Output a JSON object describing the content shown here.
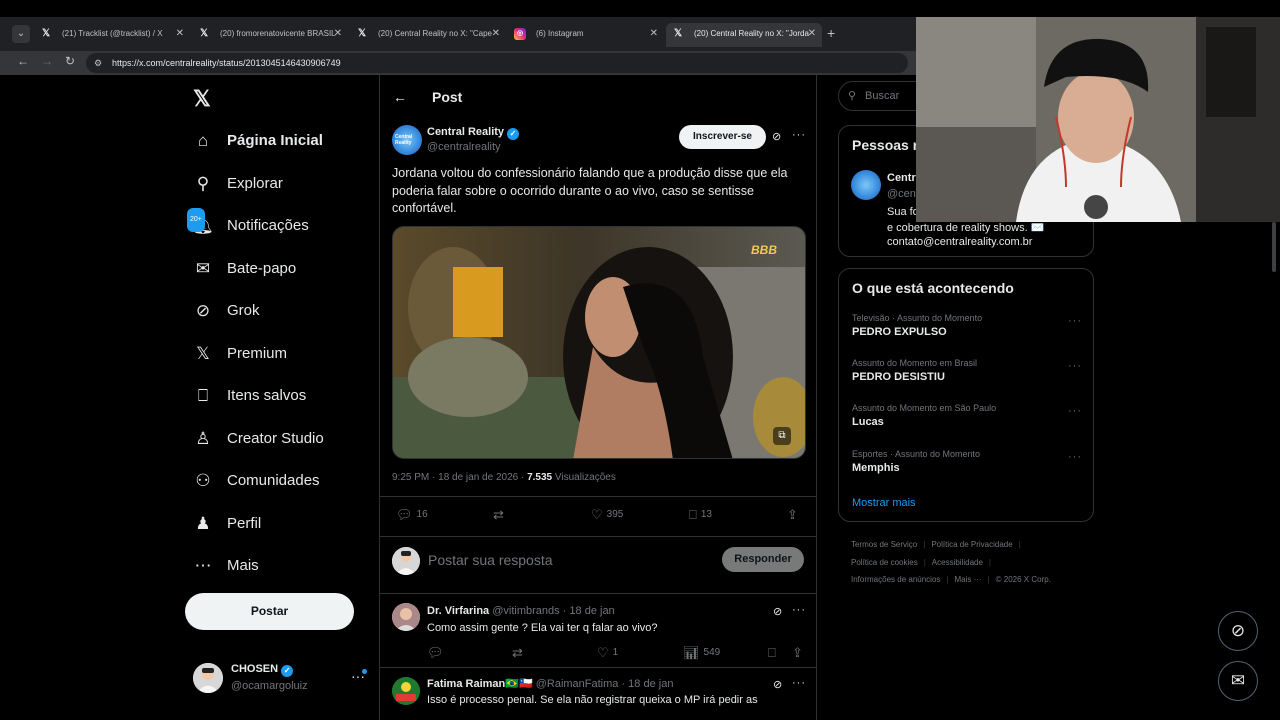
{
  "browser": {
    "tabs": [
      {
        "title": "(21) Tracklist (@tracklist) / X",
        "icon": "x-logo"
      },
      {
        "title": "(20) fromorenatovicente BRASIL",
        "icon": "x-logo"
      },
      {
        "title": "(20) Central Reality no X: \"Cape",
        "icon": "x-logo"
      },
      {
        "title": "(6) Instagram",
        "icon": "instagram-logo"
      },
      {
        "title": "(20) Central Reality no X: \"Jorda",
        "icon": "x-logo",
        "active": true
      }
    ],
    "url": "https://x.com/centralreality/status/2013045146430906749"
  },
  "nav": {
    "items": [
      {
        "label": "Página Inicial",
        "icon": "home-icon"
      },
      {
        "label": "Explorar",
        "icon": "search-icon"
      },
      {
        "label": "Notificações",
        "icon": "bell-icon",
        "badge": "20+"
      },
      {
        "label": "Bate-papo",
        "icon": "mail-icon"
      },
      {
        "label": "Grok",
        "icon": "grok-icon"
      },
      {
        "label": "Premium",
        "icon": "x-logo-icon"
      },
      {
        "label": "Itens salvos",
        "icon": "bookmark-icon"
      },
      {
        "label": "Creator Studio",
        "icon": "creator-studio-icon"
      },
      {
        "label": "Comunidades",
        "icon": "communities-icon"
      },
      {
        "label": "Perfil",
        "icon": "profile-icon"
      },
      {
        "label": "Mais",
        "icon": "more-circle-icon"
      }
    ],
    "post_button": "Postar",
    "account": {
      "name": "CHOSEN",
      "handle": "@ocamargoluiz"
    }
  },
  "post": {
    "header": "Post",
    "author": {
      "name": "Central Reality",
      "handle": "@centralreality",
      "avatar_text": "Central Reality"
    },
    "subscribe_label": "Inscrever-se",
    "text": "Jordana voltou do confessionário falando que a produção disse que ela poderia falar sobre o ocorrido durante o ao vivo, caso se sentisse confortável.",
    "media_badge": "BBB",
    "timestamp": "9:25 PM · 18 de jan de 2026 · ",
    "views_count": "7.535",
    "views_label": "Visualizações",
    "stats": {
      "replies": "16",
      "retweets": "",
      "likes": "395",
      "bookmarks": "13"
    }
  },
  "reply_box": {
    "placeholder": "Postar sua resposta",
    "button": "Responder"
  },
  "replies": [
    {
      "name": "Dr. Virfarina",
      "handle": "@vitimbrands · 18 de jan",
      "text": "Como assim gente ? Ela vai ter q falar ao vivo?",
      "replies": "",
      "retweets": "",
      "likes": "1",
      "views": "549"
    },
    {
      "name": "Fatima Raiman",
      "flags": "🇧🇷🇨🇱",
      "handle": "@RaimanFatima · 18 de jan",
      "text": "Isso é  processo penal. Se ela não registrar queixa o MP irá pedir as"
    }
  ],
  "sidebar": {
    "search_placeholder": "Buscar",
    "who_to_follow": {
      "title": "Pessoas r",
      "name": "Centr",
      "handle": "@cen",
      "bio1": "Sua fo",
      "bio2": "e cobertura de reality shows. ✉️",
      "bio3": "contato@centralreality.com.br"
    },
    "trending": {
      "title": "O que está acontecendo",
      "items": [
        {
          "context": "Televisão · Assunto do Momento",
          "name": "PEDRO EXPULSO"
        },
        {
          "context": "Assunto do Momento em Brasil",
          "name": "PEDRO DESISTIU"
        },
        {
          "context": "Assunto do Momento em São Paulo",
          "name": "Lucas"
        },
        {
          "context": "Esportes · Assunto do Momento",
          "name": "Memphis"
        }
      ],
      "show_more": "Mostrar mais"
    },
    "footer": {
      "links": [
        "Termos de Serviço",
        "Política de Privacidade",
        "Política de cookies",
        "Acessibilidade",
        "Informações de anúncios",
        "Mais ···"
      ],
      "copyright": "© 2026 X Corp."
    }
  },
  "colors": {
    "accent": "#1d9bf0",
    "background": "#000000",
    "border": "#2f3336",
    "muted": "#71767b"
  }
}
